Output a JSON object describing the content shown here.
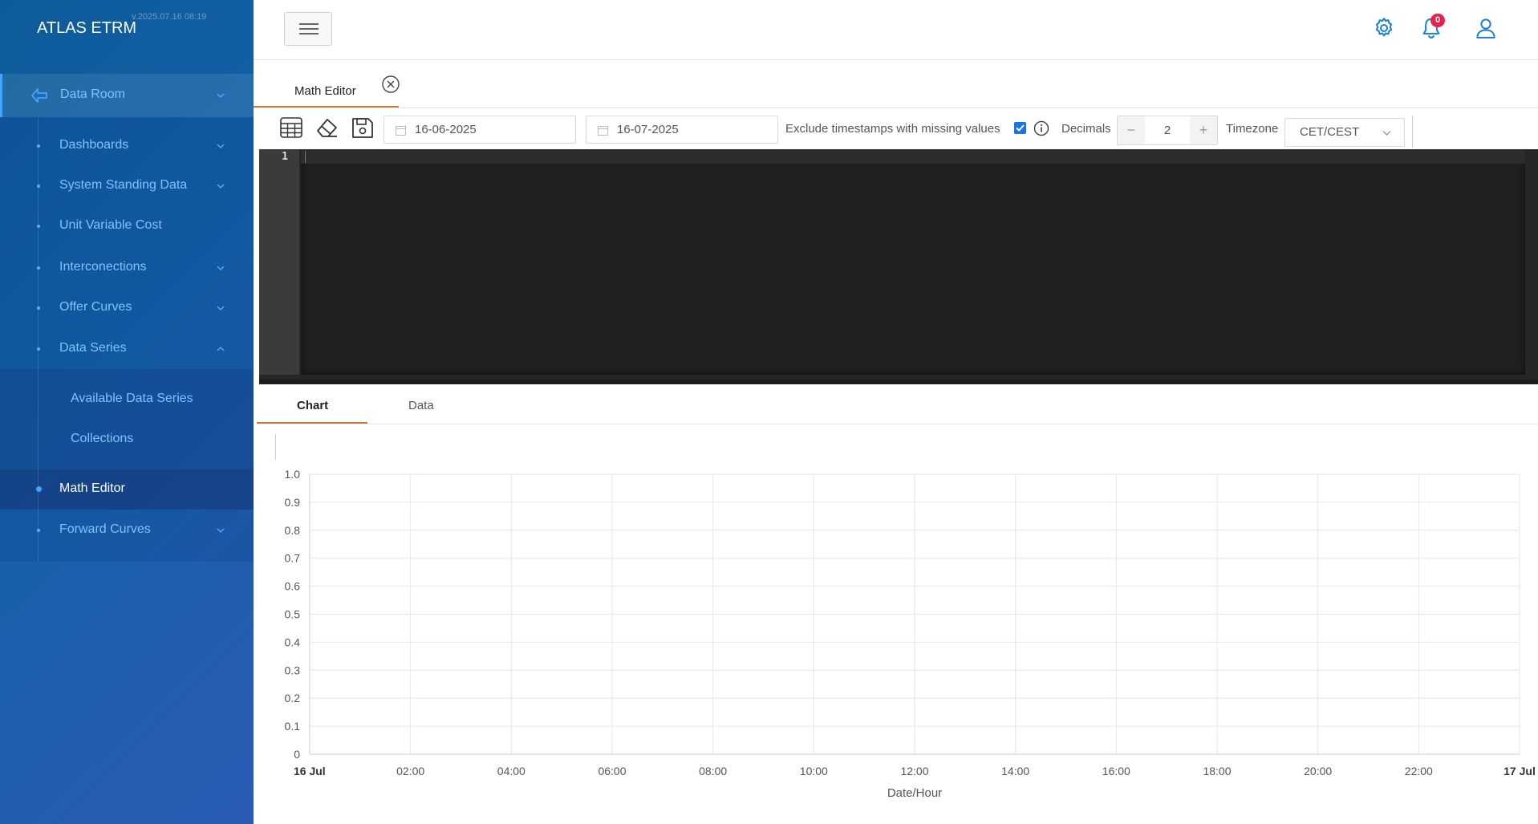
{
  "sidebar": {
    "brand": "ATLAS ETRM",
    "version": "v.2025.07.16 08:19",
    "root": {
      "label": "Data Room",
      "icon": "back-arrow-icon"
    },
    "items": [
      {
        "label": "Dashboards",
        "expandable": true
      },
      {
        "label": "System Standing Data",
        "expandable": true
      },
      {
        "label": "Unit Variable Cost",
        "expandable": false
      },
      {
        "label": "Interconections",
        "expandable": true
      },
      {
        "label": "Offer Curves",
        "expandable": true
      },
      {
        "label": "Data Series",
        "expandable": true,
        "expanded": true
      },
      {
        "label": "Math Editor",
        "expandable": false,
        "active": true
      },
      {
        "label": "Forward Curves",
        "expandable": true
      }
    ],
    "subitems": [
      {
        "label": "Available Data Series"
      },
      {
        "label": "Collections"
      }
    ]
  },
  "header": {
    "icons": [
      "menu-icon",
      "settings-icon",
      "bell-icon",
      "user-icon"
    ],
    "notification_count": "0"
  },
  "document_tab": {
    "label": "Math Editor",
    "close_icon": "close-circle-icon"
  },
  "toolbar": {
    "icons": [
      "table-icon",
      "eraser-icon",
      "save-icon"
    ],
    "start_date": "16-06-2025",
    "end_date": "16-07-2025",
    "exclude_label": "Exclude timestamps with missing values",
    "exclude_checked": true,
    "decimals_label": "Decimals",
    "decimals_value": "2",
    "decimals_minus": "−",
    "decimals_plus": "+",
    "timezone_label": "Timezone",
    "timezone_value": "CET/CEST"
  },
  "editor": {
    "line_numbers": [
      "1"
    ],
    "content": ""
  },
  "result_tabs": [
    {
      "label": "Chart",
      "active": true
    },
    {
      "label": "Data",
      "active": false
    }
  ],
  "chart_data": {
    "type": "line",
    "title": "",
    "xlabel": "Date/Hour",
    "ylabel": "",
    "ylim": [
      0,
      1
    ],
    "yticks": [
      "0",
      "0.1",
      "0.2",
      "0.3",
      "0.4",
      "0.5",
      "0.6",
      "0.7",
      "0.8",
      "0.9",
      "1.0"
    ],
    "xticks": [
      "16 Jul",
      "02:00",
      "04:00",
      "06:00",
      "08:00",
      "10:00",
      "12:00",
      "14:00",
      "16:00",
      "18:00",
      "20:00",
      "22:00",
      "17 Jul"
    ],
    "xticks_bold": [
      "16 Jul",
      "17 Jul"
    ],
    "series": [],
    "grid": true,
    "colors": {
      "grid": "#e6e6e6",
      "axis": "#cccccc",
      "tick_text": "#555555"
    }
  },
  "colors": {
    "accent_tab": "#c8793a",
    "icon_blue": "#1a7fd1",
    "badge": "#e8214f",
    "editor_bg": "#202020"
  }
}
